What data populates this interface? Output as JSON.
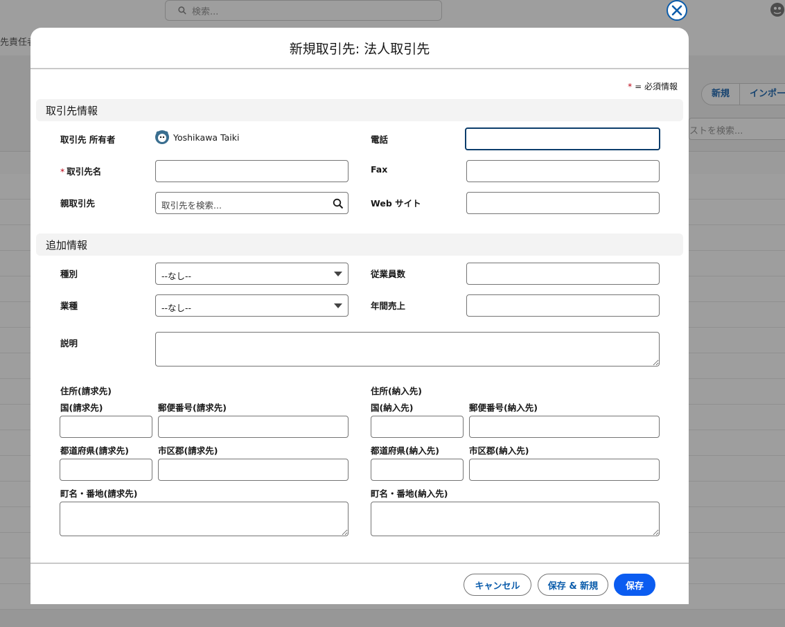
{
  "background": {
    "search_placeholder": "検索...",
    "subheader_text": "先責任者",
    "list_buttons": [
      "新規",
      "インポー"
    ],
    "list_search_placeholder": "ストを検索..."
  },
  "modal": {
    "title": "新規取引先: 法人取引先",
    "required_note": "= 必須情報",
    "required_star": "*"
  },
  "sections": {
    "account_info": "取引先情報",
    "additional_info": "追加情報"
  },
  "fields": {
    "owner_label": "取引先 所有者",
    "owner_name": "Yoshikawa Taiki",
    "account_name_label": "取引先名",
    "parent_label": "親取引先",
    "parent_placeholder": "取引先を検索...",
    "phone_label": "電話",
    "fax_label": "Fax",
    "website_label": "Web サイト",
    "type_label": "種別",
    "type_value": "--なし--",
    "industry_label": "業種",
    "industry_value": "--なし--",
    "employees_label": "従業員数",
    "revenue_label": "年間売上",
    "description_label": "説明"
  },
  "billing": {
    "heading": "住所(請求先)",
    "country_label": "国(請求先)",
    "postal_label": "郵便番号(請求先)",
    "state_label": "都道府県(請求先)",
    "city_label": "市区郡(請求先)",
    "street_label": "町名・番地(請求先)"
  },
  "shipping": {
    "heading": "住所(納入先)",
    "country_label": "国(納入先)",
    "postal_label": "郵便番号(納入先)",
    "state_label": "都道府県(納入先)",
    "city_label": "市区郡(納入先)",
    "street_label": "町名・番地(納入先)"
  },
  "footer": {
    "cancel_label": "キャンセル",
    "save_new_label": "保存 & 新規",
    "save_label": "保存"
  },
  "colors": {
    "brand": "#0b5cf0",
    "link": "#0b5cab",
    "required": "#ba0517"
  }
}
